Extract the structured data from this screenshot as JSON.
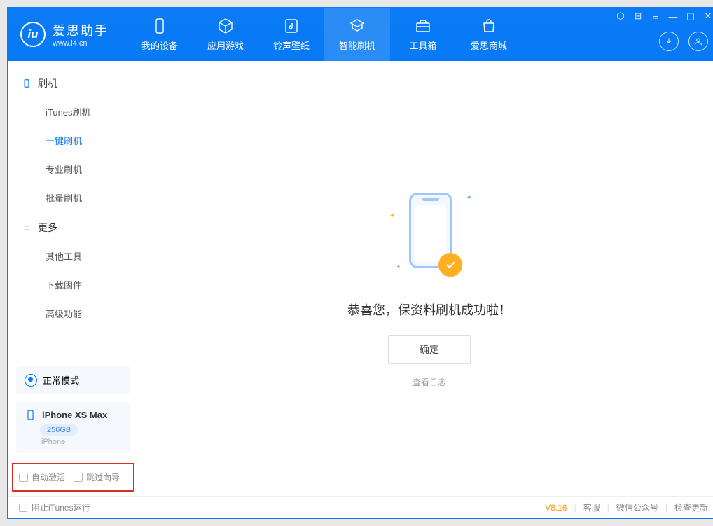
{
  "app": {
    "name": "爱思助手",
    "url": "www.i4.cn"
  },
  "nav": {
    "device": "我的设备",
    "apps": "应用游戏",
    "ring": "铃声壁纸",
    "flash": "智能刷机",
    "toolbox": "工具箱",
    "store": "爱思商城"
  },
  "sidebar": {
    "group_flash": "刷机",
    "items_flash": {
      "itunes": "iTunes刷机",
      "onekey": "一键刷机",
      "pro": "专业刷机",
      "batch": "批量刷机"
    },
    "group_more": "更多",
    "items_more": {
      "other": "其他工具",
      "firmware": "下载固件",
      "advanced": "高级功能"
    },
    "mode": "正常模式",
    "device": {
      "name": "iPhone XS Max",
      "storage": "256GB",
      "type": "iPhone"
    },
    "auto_activate": "自动激活",
    "skip_guide": "跳过向导"
  },
  "main": {
    "success": "恭喜您，保资料刷机成功啦！",
    "ok": "确定",
    "view_log": "查看日志"
  },
  "status": {
    "block_itunes": "阻止iTunes运行",
    "version": "V8.16",
    "support": "客服",
    "wechat": "微信公众号",
    "update": "检查更新"
  }
}
